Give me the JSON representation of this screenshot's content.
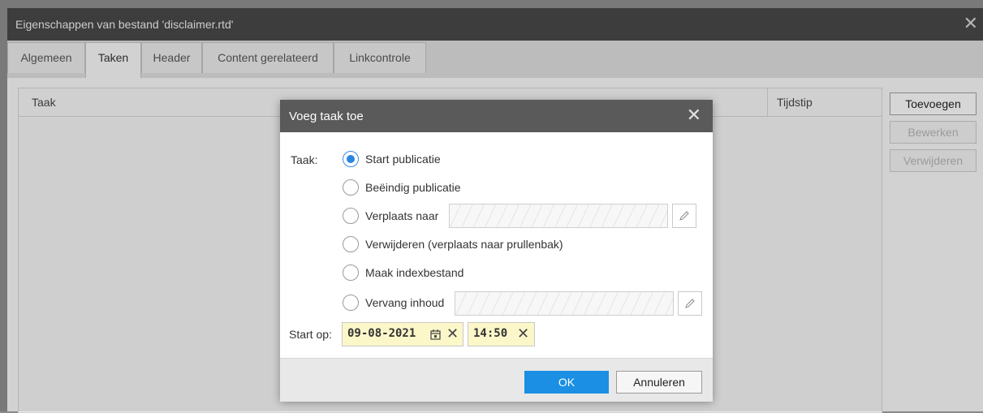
{
  "window": {
    "title": "Eigenschappen van bestand 'disclaimer.rtd'",
    "close": "✕"
  },
  "tabs": [
    {
      "label": "Algemeen"
    },
    {
      "label": "Taken"
    },
    {
      "label": "Header"
    },
    {
      "label": "Content gerelateerd"
    },
    {
      "label": "Linkcontrole"
    }
  ],
  "table": {
    "columns": [
      "Taak",
      "Tijdstip"
    ],
    "rows": []
  },
  "side_buttons": {
    "add": "Toevoegen",
    "edit": "Bewerken",
    "delete": "Verwijderen"
  },
  "dialog": {
    "title": "Voeg taak toe",
    "close": "✕",
    "task_label": "Taak:",
    "options": [
      {
        "label": "Start publicatie",
        "selected": true
      },
      {
        "label": "Beëindig publicatie",
        "selected": false
      },
      {
        "label": "Verplaats naar",
        "selected": false
      },
      {
        "label": "Verwijderen (verplaats naar prullenbak)",
        "selected": false
      },
      {
        "label": "Maak indexbestand",
        "selected": false
      },
      {
        "label": "Vervang inhoud",
        "selected": false
      }
    ],
    "start_label": "Start op:",
    "date": "09-08-2021",
    "time": "14:50",
    "clear_glyph": "✕",
    "ok": "OK",
    "cancel": "Annuleren"
  },
  "colors": {
    "primary": "#1a8fe4",
    "radio_selected": "#2a86e0",
    "date_field_bg": "#fbf7c9",
    "titlebar": "#464646",
    "dialog_titlebar": "#5a5a5a"
  },
  "icons": {
    "pencil": "pencil-icon",
    "calendar": "calendar-icon",
    "close": "close-icon"
  }
}
